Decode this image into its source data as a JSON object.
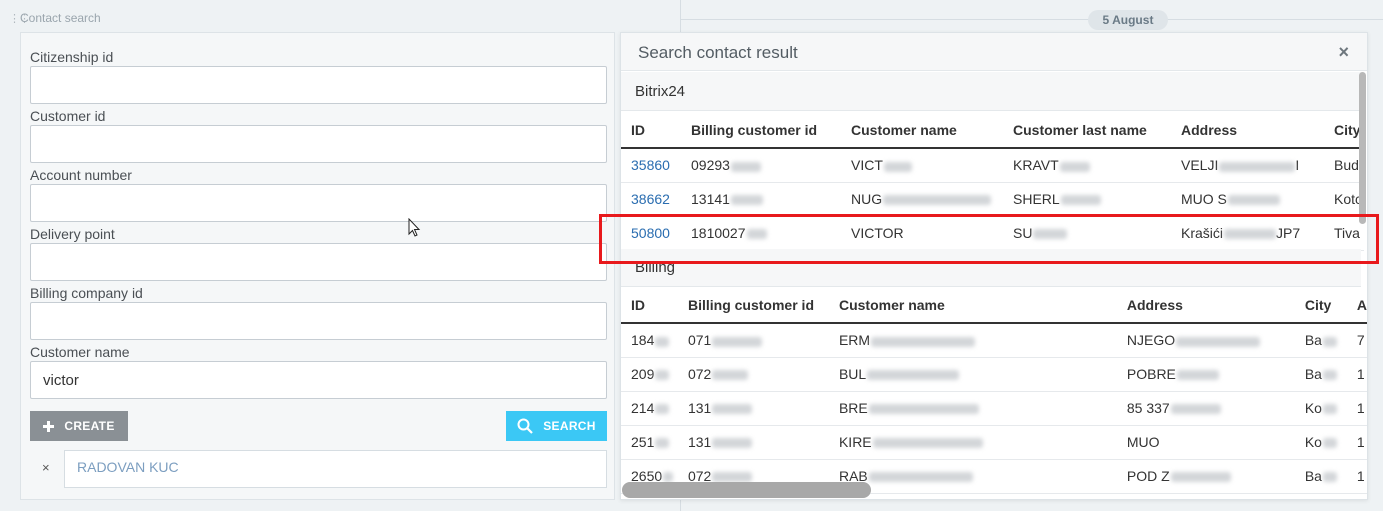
{
  "background": {
    "date_label": "5 August"
  },
  "contact_search": {
    "panel_title": "Contact search",
    "fields": [
      {
        "label": "Citizenship id",
        "value": ""
      },
      {
        "label": "Customer id",
        "value": ""
      },
      {
        "label": "Account number",
        "value": ""
      },
      {
        "label": "Delivery point",
        "value": ""
      },
      {
        "label": "Billing company id",
        "value": ""
      },
      {
        "label": "Customer name",
        "value": "victor"
      }
    ],
    "create_label": "CREATE",
    "search_label": "SEARCH",
    "selected_tag": {
      "remove": "×",
      "value": "RADOVAN KUC"
    }
  },
  "result": {
    "title": "Search contact result",
    "close": "×",
    "bitrix": {
      "title": "Bitrix24",
      "columns": [
        "ID",
        "Billing customer id",
        "Customer name",
        "Customer last name",
        "Address",
        "City"
      ],
      "rows": [
        [
          "35860",
          "09293",
          "VICT",
          "KRAVT",
          "VELJI",
          "Bud"
        ],
        [
          "38662",
          "13141",
          "NUG",
          "SHERL",
          "MUO S",
          "Kotc"
        ],
        [
          "50800",
          "1810027",
          "VICTOR",
          "SU",
          "Krašići",
          "Tiva"
        ]
      ],
      "address_suffix": [
        "I",
        "",
        "JP7"
      ]
    },
    "billing": {
      "title": "Billing",
      "columns": [
        "ID",
        "Billing customer id",
        "Customer name",
        "Address",
        "City",
        "A"
      ],
      "rows": [
        [
          "184",
          "071",
          "ERM",
          "NJEGO",
          "Ba",
          "7"
        ],
        [
          "209",
          "072",
          "BUL",
          "POBRE",
          "Ba",
          "1"
        ],
        [
          "214",
          "131",
          "BRE",
          "85 337",
          "Ko",
          "1"
        ],
        [
          "251",
          "131",
          "KIRE",
          "MUO",
          "Ko",
          "1"
        ],
        [
          "2650",
          "072",
          "RAB",
          "POD Z",
          "Ba",
          "1"
        ]
      ]
    }
  },
  "colors": {
    "accent": "#3bc8f5",
    "highlight": "#e8191c",
    "link": "#2a6db0"
  }
}
